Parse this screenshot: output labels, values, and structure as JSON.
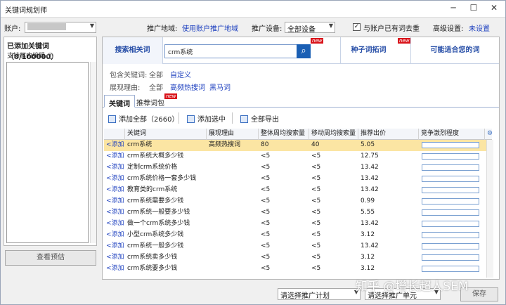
{
  "window": {
    "title": "关键词规划师"
  },
  "topbar": {
    "account_label": "账户:",
    "region_label": "推广地域:",
    "region_value": "使用账户推广地域",
    "device_label": "推广设备:",
    "device_value": "全部设备",
    "dedupe_label": "与账户已有词去重",
    "dedupe_checked": "✓",
    "advanced_label": "高级设置:",
    "advanced_value": "未设置"
  },
  "left": {
    "header": "已添加关键词（0/100000）",
    "sub": "支持框内编辑",
    "help_icon": "?",
    "preview_button": "查看预估"
  },
  "search_tabs": {
    "related": "搜索相关词",
    "seed": "种子词拓词",
    "suitable": "可能适合您的词",
    "new_badge": "new"
  },
  "search": {
    "value": "crm系统"
  },
  "filters": {
    "include_label": "包含关键词:",
    "include_all": "全部",
    "include_custom": "自定义",
    "reason_label": "展现理由:",
    "reason_all": "全部",
    "reason_hot": "高频热搜词",
    "reason_dark": "黑马词"
  },
  "tabs": {
    "keywords": "关键词",
    "recommend": "推荐词包",
    "new_badge": "new"
  },
  "toolbar": {
    "add_all": "添加全部（2660）",
    "add_selected": "添加选中",
    "export_all": "全部导出"
  },
  "table": {
    "headers": [
      "关键词",
      "展现理由",
      "整体周均搜索量",
      "移动周均搜索量",
      "推荐出价",
      "竞争激烈程度"
    ],
    "add_label": "<添加",
    "rows": [
      {
        "kw": "crm系统",
        "reason": "高频热搜词",
        "overall": "80",
        "mobile": "40",
        "bid": "5.05"
      },
      {
        "kw": "crm系统大概多少钱",
        "reason": "",
        "overall": "<5",
        "mobile": "<5",
        "bid": "12.75"
      },
      {
        "kw": "定制crm系统价格",
        "reason": "",
        "overall": "<5",
        "mobile": "<5",
        "bid": "13.42"
      },
      {
        "kw": "crm系统价格一套多少钱",
        "reason": "",
        "overall": "<5",
        "mobile": "<5",
        "bid": "13.42"
      },
      {
        "kw": "教育类的crm系统",
        "reason": "",
        "overall": "<5",
        "mobile": "<5",
        "bid": "13.42"
      },
      {
        "kw": "crm系统需要多少钱",
        "reason": "",
        "overall": "<5",
        "mobile": "<5",
        "bid": "0.99"
      },
      {
        "kw": "crm系统一般要多少钱",
        "reason": "",
        "overall": "<5",
        "mobile": "<5",
        "bid": "5.55"
      },
      {
        "kw": "做一个crm系统多少钱",
        "reason": "",
        "overall": "<5",
        "mobile": "<5",
        "bid": "13.42"
      },
      {
        "kw": "小型crm系统多少钱",
        "reason": "",
        "overall": "<5",
        "mobile": "<5",
        "bid": "3.12"
      },
      {
        "kw": "crm系统一般多少钱",
        "reason": "",
        "overall": "<5",
        "mobile": "<5",
        "bid": "13.42"
      },
      {
        "kw": "crm系统卖多少钱",
        "reason": "",
        "overall": "<5",
        "mobile": "<5",
        "bid": "3.12"
      },
      {
        "kw": "crm系统要多少钱",
        "reason": "",
        "overall": "<5",
        "mobile": "<5",
        "bid": "3.12"
      }
    ]
  },
  "bottom": {
    "plan_select": "请选择推广计划",
    "unit_select": "请选择推广单元",
    "save": "保存"
  },
  "watermark": "知乎 @增长超人SEM"
}
